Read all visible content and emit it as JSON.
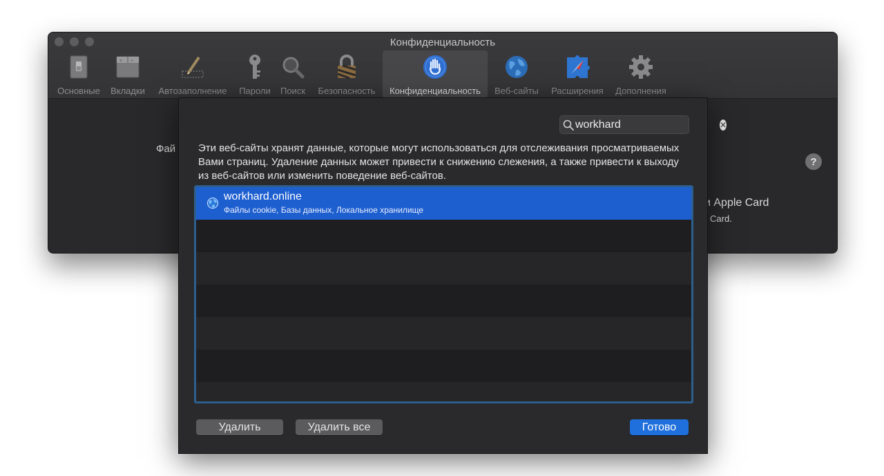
{
  "window": {
    "title": "Конфиденциальность"
  },
  "toolbar": {
    "items": [
      {
        "label": "Основные",
        "icon": "switch-icon"
      },
      {
        "label": "Вкладки",
        "icon": "tabs-icon"
      },
      {
        "label": "Автозаполнение",
        "icon": "pencil-icon"
      },
      {
        "label": "Пароли",
        "icon": "key-icon"
      },
      {
        "label": "Поиск",
        "icon": "magnifier-icon"
      },
      {
        "label": "Безопасность",
        "icon": "lock-icon"
      },
      {
        "label": "Конфиденциальность",
        "icon": "hand-icon",
        "active": true
      },
      {
        "label": "Веб-сайты",
        "icon": "globe-icon"
      },
      {
        "label": "Расширения",
        "icon": "extensions-icon"
      },
      {
        "label": "Дополнения",
        "icon": "gear-icon"
      }
    ]
  },
  "behind": {
    "left_fragment": "Фай",
    "right_line1": "и Apple Card",
    "right_line2": "Card.",
    "help": "?"
  },
  "sheet": {
    "search": {
      "value": "workhard",
      "clear": "✕"
    },
    "description": "Эти веб-сайты хранят данные, которые могут использоваться для отслеживания просматриваемых Вами страниц. Удаление данных может привести к снижению слежения, а также привести к выходу из веб-сайтов или изменить поведение веб-сайтов.",
    "sites": [
      {
        "name": "workhard.online",
        "detail": "Файлы cookie, Базы данных, Локальное хранилище"
      }
    ],
    "buttons": {
      "remove": "Удалить",
      "remove_all": "Удалить все",
      "done": "Готово"
    }
  },
  "colors": {
    "accent": "#1e5fd0",
    "list_border": "#2d5f8e",
    "window_bg": "#2b2b2d"
  }
}
